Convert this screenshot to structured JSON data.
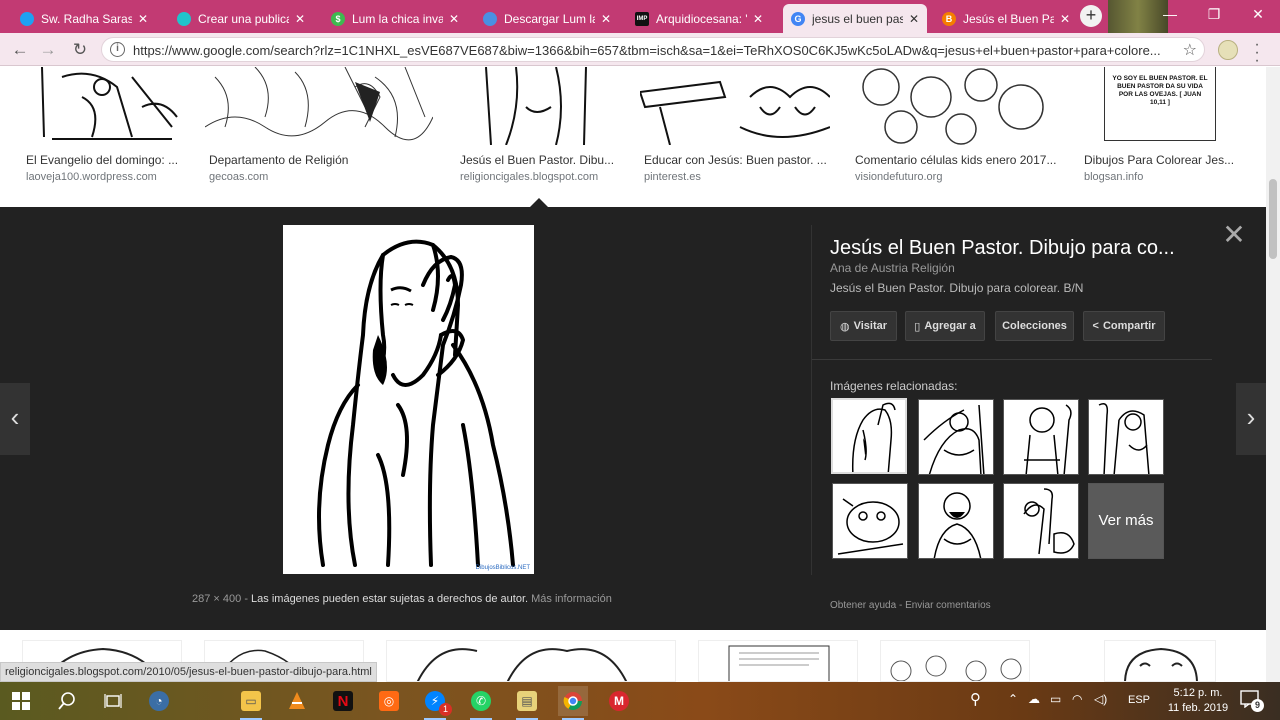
{
  "browser": {
    "tabs": [
      {
        "title": "Sw. Radha Sarasw",
        "icon": "twitter-icon",
        "color": "#1da1f2",
        "glyph": ""
      },
      {
        "title": "Crear una publicac",
        "icon": "canva-icon",
        "color": "#20c4cb",
        "glyph": ""
      },
      {
        "title": "Lum la chica invas",
        "icon": "dollar-icon",
        "color": "#3fb950",
        "glyph": "$"
      },
      {
        "title": "Descargar Lum la",
        "icon": "cloud-icon",
        "color": "#4a90e2",
        "glyph": ""
      },
      {
        "title": "Arquidiocesana: \"J",
        "icon": "imp-icon",
        "color": "#111111",
        "glyph": "IMP"
      },
      {
        "title": "jesus el buen pasto",
        "icon": "google-icon",
        "color": "#4285f4",
        "glyph": "G"
      },
      {
        "title": "Jesús el Buen Past",
        "icon": "blogger-icon",
        "color": "#f57d00",
        "glyph": "B"
      }
    ],
    "active_tab": 5,
    "url": "https://www.google.com/search?rlz=1C1NHXL_esVE687VE687&biw=1366&bih=657&tbm=isch&sa=1&ei=TeRhXOS0C6KJ5wKc5oLADw&q=jesus+el+buen+pastor+para+colore...",
    "accent": "#c23a73"
  },
  "results": [
    {
      "caption": "El Evangelio del domingo: ...",
      "source": "laoveja100.wordpress.com"
    },
    {
      "caption": "Departamento de Religión",
      "source": "gecoas.com"
    },
    {
      "caption": "Jesús el Buen Pastor. Dibu...",
      "source": "religioncigales.blogspot.com"
    },
    {
      "caption": "Educar con Jesús: Buen pastor. ...",
      "source": "pinterest.es"
    },
    {
      "caption": "Comentario células kids enero 2017...",
      "source": "visiondefuturo.org"
    },
    {
      "caption": "Dibujos Para Colorear Jes...",
      "source": "blogsan.info"
    }
  ],
  "result6_text": "YO SOY EL BUEN PASTOR. EL BUEN PASTOR DA SU VIDA POR LAS OVEJAS. [ JUAN 10,11 ]",
  "preview": {
    "title": "Jesús el Buen Pastor. Dibujo para co...",
    "author": "Ana de Austria Religión",
    "description": "Jesús el Buen Pastor. Dibujo para colorear. B/N",
    "buttons": {
      "visit": "Visitar",
      "save": "Agregar a",
      "collections": "Colecciones",
      "share": "Compartir"
    },
    "related_label": "Imágenes relacionadas:",
    "see_more": "Ver más",
    "dimensions": "287 × 400",
    "copyright": "Las imágenes pueden estar sujetas a derechos de autor.",
    "more_info": "Más información",
    "help": "Obtener ayuda",
    "feedback": "Enviar comentarios",
    "watermark": "DibujosBiblicos.NET"
  },
  "status_link": "religioncigales.blogspot.com/2010/05/jesus-el-buen-pastor-dibujo-para.html",
  "taskbar": {
    "language": "ESP",
    "time": "5:12 p. m.",
    "date": "11 feb. 2019",
    "notifications": "9",
    "messenger_badge": "1"
  }
}
